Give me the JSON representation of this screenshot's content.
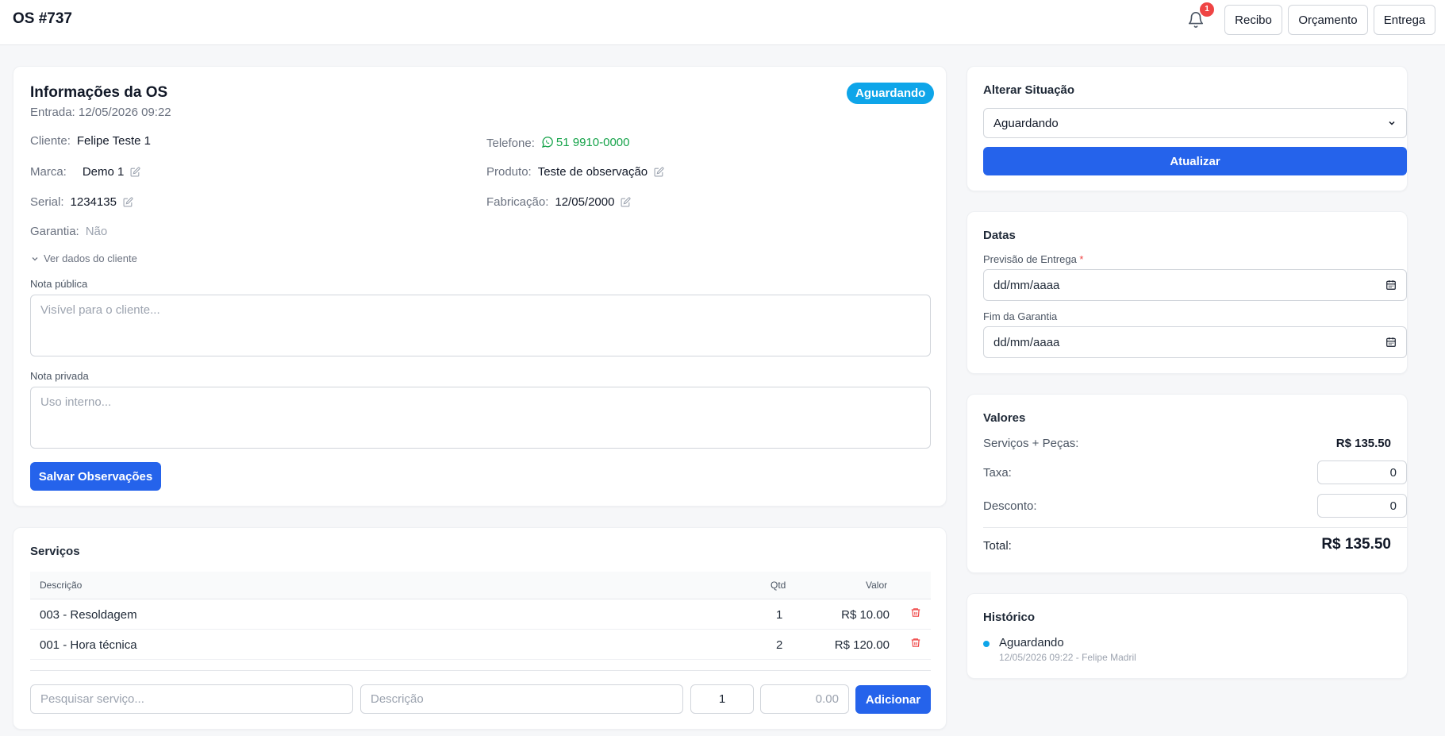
{
  "header": {
    "title": "OS #737",
    "notification_count": "1",
    "buttons": {
      "recibo": "Recibo",
      "orcamento": "Orçamento",
      "entrega": "Entrega"
    }
  },
  "info": {
    "title": "Informações da OS",
    "entrada": "Entrada: 12/05/2026 09:22",
    "status": "Aguardando",
    "fields": {
      "cliente_label": "Cliente:",
      "cliente": "Felipe Teste 1",
      "telefone_label": "Telefone:",
      "telefone": "51 9910-0000",
      "marca_label": "Marca:",
      "marca": "Demo 1",
      "produto_label": "Produto:",
      "produto": "Teste de observação",
      "serial_label": "Serial:",
      "serial": "1234135",
      "fabricacao_label": "Fabricação:",
      "fabricacao": "12/05/2000",
      "garantia_label": "Garantia:",
      "garantia": "Não"
    },
    "ver_dados": "Ver dados do cliente",
    "nota_publica_label": "Nota pública",
    "nota_publica_placeholder": "Visível para o cliente...",
    "nota_privada_label": "Nota privada",
    "nota_privada_placeholder": "Uso interno...",
    "save_label": "Salvar Observações"
  },
  "servicos": {
    "title": "Serviços",
    "columns": {
      "descricao": "Descrição",
      "qtd": "Qtd",
      "valor": "Valor"
    },
    "rows": [
      {
        "descricao": "003 - Resoldagem",
        "qtd": "1",
        "valor": "R$ 10.00"
      },
      {
        "descricao": "001 - Hora técnica",
        "qtd": "2",
        "valor": "R$ 120.00"
      }
    ],
    "search_placeholder": "Pesquisar serviço...",
    "desc_placeholder": "Descrição",
    "qty_value": "1",
    "price_placeholder": "0.00",
    "add_label": "Adicionar"
  },
  "situacao": {
    "title": "Alterar Situação",
    "selected": "Aguardando",
    "update_label": "Atualizar"
  },
  "datas": {
    "title": "Datas",
    "previsao_label": "Previsão de Entrega",
    "required_mark": "*",
    "previsao_value": "dd/mm/aaaa",
    "garantia_label": "Fim da Garantia",
    "garantia_value": "dd/mm/aaaa"
  },
  "valores": {
    "title": "Valores",
    "servicos_pecas_label": "Serviços + Peças:",
    "servicos_pecas_value": "R$ 135.50",
    "taxa_label": "Taxa:",
    "taxa_value": "0",
    "desconto_label": "Desconto:",
    "desconto_value": "0",
    "total_label": "Total:",
    "total_value": "R$ 135.50"
  },
  "historico": {
    "title": "Histórico",
    "entries": [
      {
        "status": "Aguardando",
        "meta": "12/05/2026 09:22 - Felipe Madril"
      }
    ]
  },
  "colors": {
    "primary": "#2563eb",
    "status": "#0ea5e9",
    "whatsapp": "#16a34a",
    "danger": "#ef4444"
  }
}
